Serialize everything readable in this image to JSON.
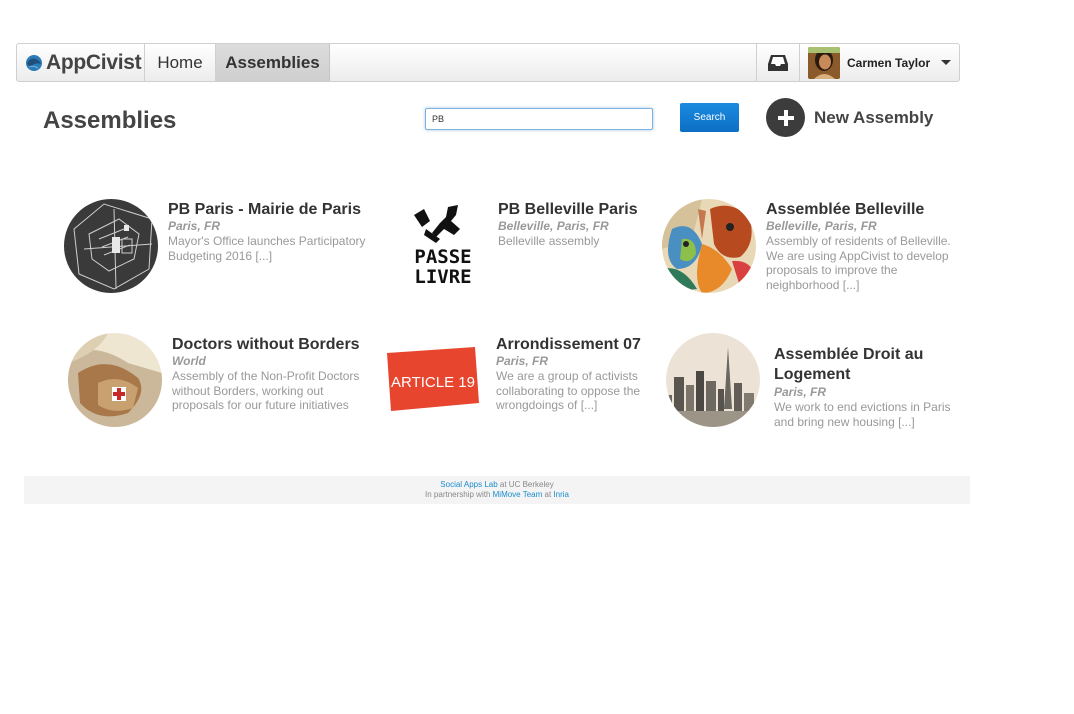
{
  "nav": {
    "brand": "AppCivist",
    "home_label": "Home",
    "assemblies_label": "Assemblies",
    "user_name": "Carmen Taylor",
    "inbox_icon": "inbox-icon",
    "caret_icon": "caret-down-icon"
  },
  "header": {
    "title": "Assemblies",
    "search_value": "PB",
    "search_button": "Search",
    "new_assembly_label": "New Assembly"
  },
  "assemblies": [
    {
      "title": "PB Paris - Mairie de Paris",
      "location": "Paris, FR",
      "description": "Mayor's Office launches Participatory Budgeting 2016 [...]"
    },
    {
      "title": "PB Belleville Paris",
      "location": "Belleville, Paris, FR",
      "description": "Belleville assembly"
    },
    {
      "title": "Assemblée Belleville",
      "location": "Belleville, Paris, FR",
      "description": "Assembly of residents of Belleville. We are using AppCivist to develop proposals to improve the neighborhood [...]"
    },
    {
      "title": "Doctors without Borders",
      "location": "World",
      "description": "Assembly of the Non-Profit Doctors without Borders, working out proposals for our future initiatives"
    },
    {
      "title": "Arrondissement 07",
      "location": "Paris, FR",
      "description": "We are a group of activists collaborating to oppose the wrongdoings of [...]"
    },
    {
      "title": "Assemblée Droit au Logement",
      "location": "Paris, FR",
      "description": "We work to end evictions in Paris and bring new housing [...]"
    }
  ],
  "logos": {
    "passe_line1": "PASSE",
    "passe_line2": "LIVRE",
    "article": "ARTICLE 19"
  },
  "footer": {
    "lab_link": "Social Apps Lab",
    "lab_suffix": " at UC Berkeley",
    "partner_prefix": "In partnership with ",
    "mimove_link": "MiMove Team",
    "at_text": " at ",
    "inria_link": "Inria"
  },
  "colors": {
    "accent": "#0c6fc4",
    "link": "#1a8ccf",
    "article_red": "#e8452f"
  }
}
